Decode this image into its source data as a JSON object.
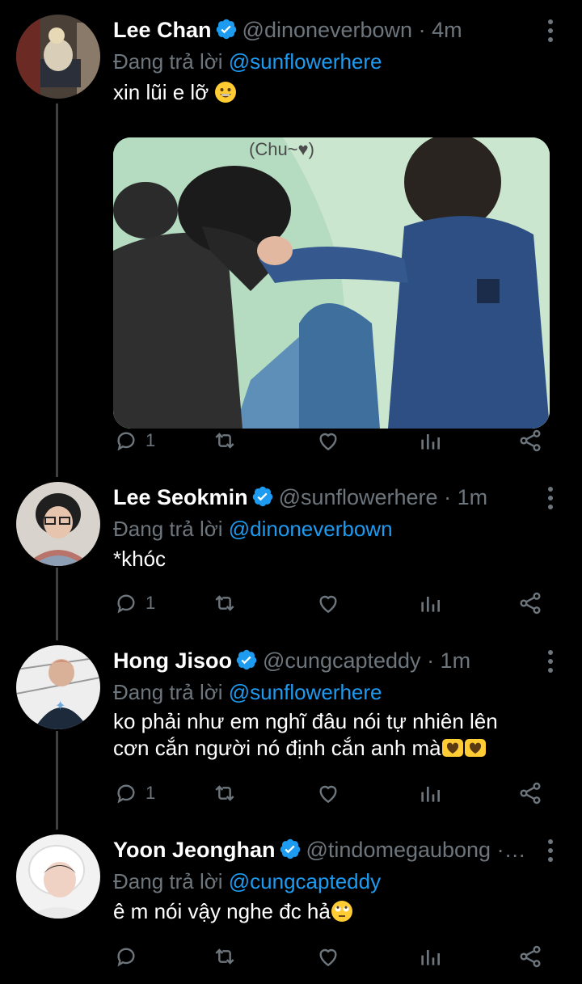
{
  "tweets": [
    {
      "name": "Lee Chan",
      "handle": "@dinoneverbown",
      "time": "· 4m",
      "reply_prefix": "Đang trả lời ",
      "reply_to": "@sunflowerhere",
      "text": "xin lũi e lỡ",
      "text_emoji": "grinning-face",
      "media_caption": "(Chu~♥)",
      "reply_count": "1"
    },
    {
      "name": "Lee Seokmin",
      "handle": "@sunflowerhere",
      "time": "· 1m",
      "reply_prefix": "Đang trả lời ",
      "reply_to": "@dinoneverbown",
      "text": "*khóc",
      "reply_count": "1"
    },
    {
      "name": "Hong Jisoo",
      "handle": "@cungcapteddy",
      "time": "· 1m",
      "reply_prefix": "Đang trả lời ",
      "reply_to": "@sunflowerhere",
      "text_line1": "ko phải như em nghĩ đâu nói tự nhiên lên",
      "text_line2": "cơn cắn người nó định cắn anh mà",
      "text_emoji": "hands-heart",
      "reply_count": "1"
    },
    {
      "name": "Yoon Jeonghan",
      "handle": "@tindomegaubong ·…",
      "reply_prefix": "Đang trả lời ",
      "reply_to": "@cungcapteddy",
      "text": "ê m nói vậy nghe đc hả",
      "text_emoji": "rolling-eyes-face"
    }
  ],
  "colors": {
    "background": "#000000",
    "secondary_text": "#6e767d",
    "accent": "#1d9bf0",
    "thread_line": "#3e4144"
  },
  "icons": [
    "verified-badge-icon",
    "more-icon",
    "reply-icon",
    "retweet-icon",
    "like-icon",
    "analytics-icon",
    "share-icon"
  ]
}
